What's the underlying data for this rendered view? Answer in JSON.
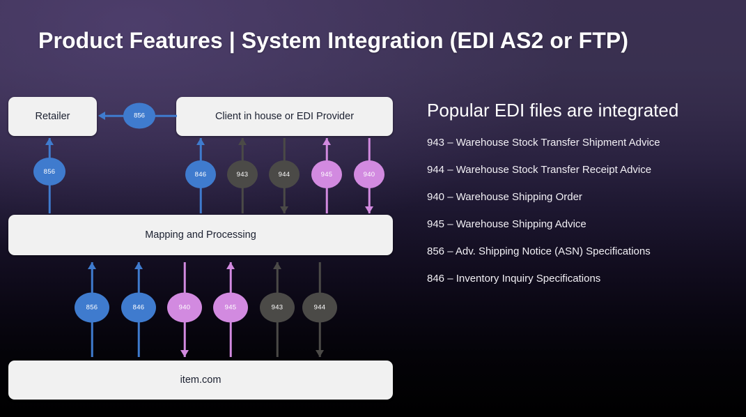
{
  "slide": {
    "title": "Product Features  |  System Integration (EDI AS2 or FTP)",
    "background_top": "#3b3052",
    "background_bottom": "#000000"
  },
  "colors": {
    "blue": "#3f7bce",
    "pink": "#d28ae0",
    "gray": "#4b4a47",
    "box_fill": "#f1f1f1",
    "box_text": "#1b2030",
    "legend_text": "#f2f0f5"
  },
  "diagram": {
    "boxes": {
      "retailer": "Retailer",
      "client": "Client in house or EDI Provider",
      "mapping": "Mapping and Processing",
      "site": "item.com"
    },
    "horizontal_flow": {
      "label": "856",
      "color": "blue",
      "direction": "left"
    },
    "retailer_to_mapping": [
      {
        "label": "856",
        "color": "blue",
        "direction": "up"
      }
    ],
    "client_to_mapping": [
      {
        "label": "846",
        "color": "blue",
        "direction": "up"
      },
      {
        "label": "943",
        "color": "gray",
        "direction": "up"
      },
      {
        "label": "944",
        "color": "gray",
        "direction": "down"
      },
      {
        "label": "945",
        "color": "pink",
        "direction": "up"
      },
      {
        "label": "940",
        "color": "pink",
        "direction": "down"
      }
    ],
    "mapping_to_site": [
      {
        "label": "856",
        "color": "blue",
        "direction": "up"
      },
      {
        "label": "846",
        "color": "blue",
        "direction": "up"
      },
      {
        "label": "940",
        "color": "pink",
        "direction": "down"
      },
      {
        "label": "945",
        "color": "pink",
        "direction": "up"
      },
      {
        "label": "943",
        "color": "gray",
        "direction": "up"
      },
      {
        "label": "944",
        "color": "gray",
        "direction": "down"
      }
    ]
  },
  "legend": {
    "title": "Popular EDI files are integrated",
    "items": [
      "943 – Warehouse Stock Transfer Shipment Advice",
      "944 – Warehouse Stock Transfer Receipt Advice",
      "940 – Warehouse Shipping Order",
      "945 – Warehouse Shipping Advice",
      "856 – Adv. Shipping Notice (ASN) Specifications",
      "846 – Inventory Inquiry Specifications"
    ]
  }
}
